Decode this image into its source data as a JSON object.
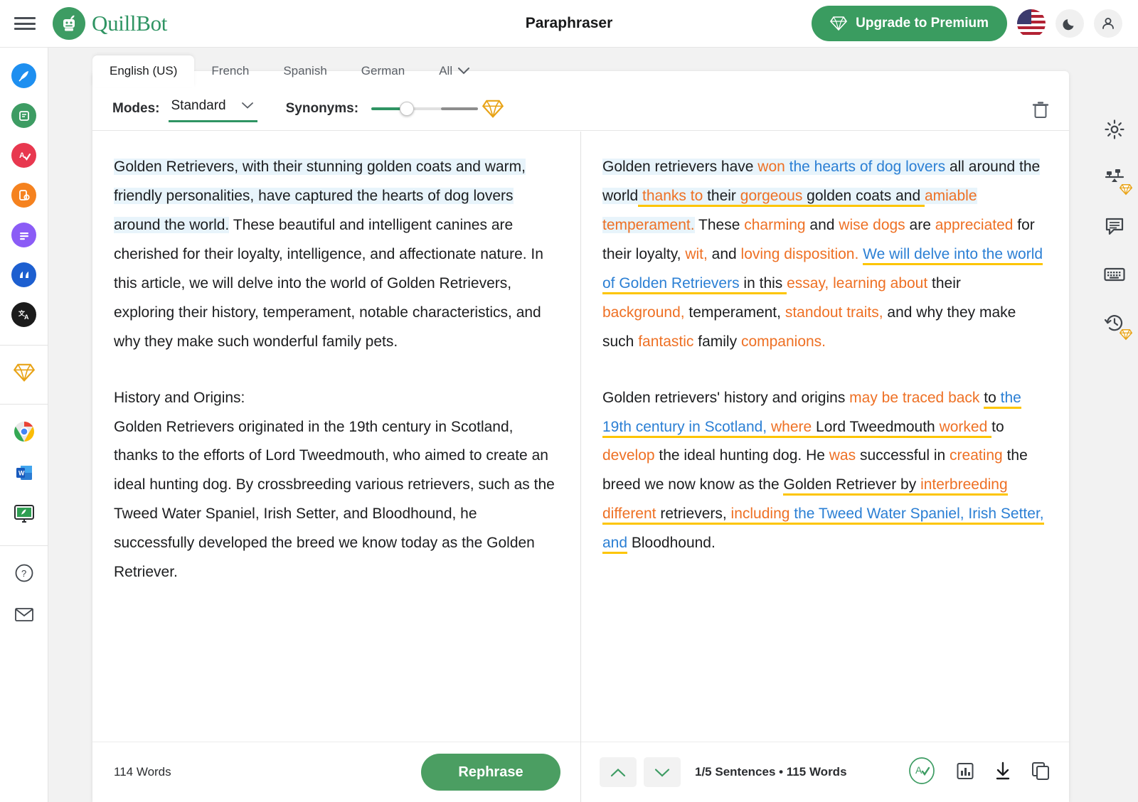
{
  "app": {
    "title": "Paraphraser",
    "brand": "QuillBot",
    "accent_green": "#2f9463",
    "gold": "#e8a317",
    "orange": "#ee7024",
    "blue": "#2b7fd4",
    "underline_yellow": "#fdc500",
    "highlight_blue": "#e8f4fb"
  },
  "header": {
    "menu_icon": "hamburger-icon",
    "logo_icon": "quillbot-robot-icon",
    "upgrade_label": "Upgrade to Premium",
    "upgrade_icon": "diamond-icon",
    "flag_icon": "us-flag-icon",
    "theme_icon": "moon-icon",
    "account_icon": "account-icon"
  },
  "left_rail": {
    "items": [
      {
        "name": "ai-writer",
        "icon": "quill-pen-icon",
        "color": "#1e8ff0",
        "active": false
      },
      {
        "name": "paraphraser",
        "icon": "paraphrase-icon",
        "color": "#3d9c63",
        "active": true
      },
      {
        "name": "grammar-checker",
        "icon": "grammar-check-icon",
        "color": "#e8384f",
        "active": false
      },
      {
        "name": "plagiarism-checker",
        "icon": "plagiarism-icon",
        "color": "#f5821f",
        "active": false
      },
      {
        "name": "summarizer",
        "icon": "summarizer-icon",
        "color": "#8b5cf6",
        "active": false
      },
      {
        "name": "citation-generator",
        "icon": "quote-icon",
        "color": "#1d5fd0",
        "active": false
      },
      {
        "name": "translator",
        "icon": "translate-icon",
        "color": "#1b1b1b",
        "active": false
      }
    ],
    "premium_icon": "premium-diamond-icon",
    "apps": [
      {
        "name": "chrome-extension",
        "icon": "chrome-icon"
      },
      {
        "name": "word-addin",
        "icon": "ms-word-icon"
      },
      {
        "name": "desktop-app",
        "icon": "desktop-app-icon"
      }
    ],
    "help_icon": "help-circle-icon",
    "mail_icon": "mail-icon"
  },
  "tabs": [
    {
      "label": "English (US)",
      "active": true
    },
    {
      "label": "French",
      "active": false
    },
    {
      "label": "Spanish",
      "active": false
    },
    {
      "label": "German",
      "active": false
    },
    {
      "label": "All",
      "active": false,
      "icon": "chevron-down-icon"
    }
  ],
  "toolbar": {
    "modes_label": "Modes:",
    "mode_value": "Standard",
    "mode_caret_icon": "caret-down-icon",
    "synonyms_label": "Synonyms:",
    "synonyms_value": 33,
    "synonyms_gem_icon": "gold-diamond-icon",
    "trash_icon": "trash-icon"
  },
  "input_panel": {
    "paragraph1": {
      "highlighted": "Golden Retrievers, with their stunning golden coats and warm, friendly personalities, have captured the hearts of dog lovers around the world.",
      "rest": " These beautiful and intelligent canines are cherished for their loyalty, intelligence, and affectionate nature. In this article, we will delve into the world of Golden Retrievers, exploring their history, temperament, notable characteristics, and why they make such wonderful family pets."
    },
    "heading2": "History and Origins:",
    "paragraph2": "Golden Retrievers originated in the 19th century in Scotland, thanks to the efforts of Lord Tweedmouth, who aimed to create an ideal hunting dog. By crossbreeding various retrievers, such as the Tweed Water Spaniel, Irish Setter, and Bloodhound, he successfully developed the breed we know today as the Golden Retriever.",
    "word_count": "114 Words",
    "rephrase_label": "Rephrase"
  },
  "output_panel": {
    "paragraph1_tokens": [
      {
        "t": "Golden retrievers have ",
        "s": "plain",
        "hl": true
      },
      {
        "t": "won ",
        "s": "orange",
        "hl": true
      },
      {
        "t": "the hearts of dog lovers ",
        "s": "blue",
        "hl": true
      },
      {
        "t": "all around the world",
        "s": "orange-blue-mix",
        "hl": true
      },
      {
        "t": " thanks to ",
        "s": "orange",
        "hl": true,
        "ul": true
      },
      {
        "t": "their ",
        "s": "plain",
        "hl": true,
        "ul": true
      },
      {
        "t": "gorgeous ",
        "s": "orange",
        "hl": true,
        "ul": true
      },
      {
        "t": "golden coats and ",
        "s": "plain",
        "hl": true,
        "ul": true
      },
      {
        "t": "amiable temperament.",
        "s": "orange",
        "hl": true
      },
      {
        "t": " These ",
        "s": "plain"
      },
      {
        "t": "charming ",
        "s": "orange"
      },
      {
        "t": "and ",
        "s": "plain"
      },
      {
        "t": "wise dogs ",
        "s": "orange"
      },
      {
        "t": "are ",
        "s": "plain"
      },
      {
        "t": "appreciated ",
        "s": "orange"
      },
      {
        "t": "for their loyalty, ",
        "s": "plain"
      },
      {
        "t": "wit, ",
        "s": "orange"
      },
      {
        "t": "and ",
        "s": "plain"
      },
      {
        "t": "loving disposition. ",
        "s": "orange"
      },
      {
        "t": "We will delve into the world of Golden Retrievers",
        "s": "blue",
        "ul": true
      },
      {
        "t": " in this ",
        "s": "plain",
        "ul": true
      },
      {
        "t": "essay, learning about ",
        "s": "orange"
      },
      {
        "t": "their ",
        "s": "plain"
      },
      {
        "t": "background, ",
        "s": "orange"
      },
      {
        "t": "temperament, ",
        "s": "plain"
      },
      {
        "t": "standout traits, ",
        "s": "orange"
      },
      {
        "t": "and why they make such ",
        "s": "plain"
      },
      {
        "t": "fantastic ",
        "s": "orange"
      },
      {
        "t": "family ",
        "s": "plain"
      },
      {
        "t": "companions.",
        "s": "orange"
      }
    ],
    "paragraph2_tokens": [
      {
        "t": "Golden retrievers' history and origins ",
        "s": "plain"
      },
      {
        "t": "may be traced back ",
        "s": "orange"
      },
      {
        "t": "to ",
        "s": "plain",
        "ul": true
      },
      {
        "t": "the 19th century in Scotland, ",
        "s": "blue",
        "ul": true
      },
      {
        "t": "where ",
        "s": "orange",
        "ul": true
      },
      {
        "t": "Lord Tweedmouth ",
        "s": "plain",
        "ul": true
      },
      {
        "t": "worked ",
        "s": "orange",
        "ul": true
      },
      {
        "t": "to ",
        "s": "plain"
      },
      {
        "t": "develop ",
        "s": "orange"
      },
      {
        "t": "the ideal hunting dog. He ",
        "s": "plain"
      },
      {
        "t": "was ",
        "s": "orange"
      },
      {
        "t": "successful in ",
        "s": "plain"
      },
      {
        "t": "creating ",
        "s": "orange"
      },
      {
        "t": "the breed we now know as the ",
        "s": "plain"
      },
      {
        "t": "Golden Retriever by ",
        "s": "plain",
        "ul": true
      },
      {
        "t": "interbreeding different ",
        "s": "orange",
        "ul": true
      },
      {
        "t": "retrievers, ",
        "s": "plain",
        "ul": true
      },
      {
        "t": "including ",
        "s": "orange",
        "ul": true
      },
      {
        "t": "the Tweed Water Spaniel, Irish Setter, and",
        "s": "blue",
        "ul": true
      },
      {
        "t": " Bloodhound.",
        "s": "plain"
      }
    ],
    "prev_icon": "chevron-up-icon",
    "next_icon": "chevron-down-icon",
    "status": "1/5 Sentences  •  115 Words",
    "grammar_icon": "grammar-check-circle-icon",
    "stats_icon": "bar-chart-icon",
    "download_icon": "download-icon",
    "copy_icon": "copy-icon"
  },
  "right_rail": {
    "items": [
      {
        "name": "settings",
        "icon": "gear-icon",
        "premium": false
      },
      {
        "name": "compare-modes",
        "icon": "compare-balance-icon",
        "premium": true
      },
      {
        "name": "feedback",
        "icon": "comment-icon",
        "premium": false
      },
      {
        "name": "keyboard-shortcuts",
        "icon": "keyboard-icon",
        "premium": false
      },
      {
        "name": "history",
        "icon": "history-clock-icon",
        "premium": true
      }
    ]
  }
}
